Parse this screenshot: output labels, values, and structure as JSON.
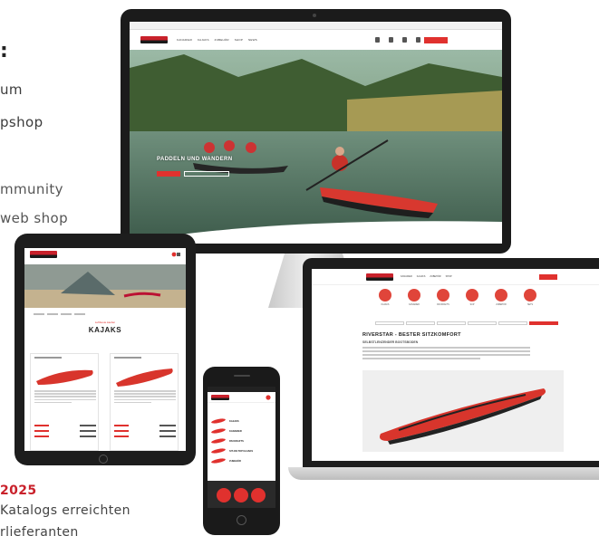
{
  "left_text": {
    "colon": ":",
    "line1": "um",
    "line2": "pshop",
    "line3": "mmunity",
    "line4": "web shop",
    "year": "2025",
    "line5": "Katalogs erreichten",
    "line6": "rlieferanten"
  },
  "desktop": {
    "nav_items": [
      "KANADIER",
      "KAJAKS",
      "ZUBEHÖR",
      "SHOP",
      "NEWS"
    ],
    "cta_label": "",
    "hero_headline": "PADDELN UND WANDERN"
  },
  "laptop": {
    "nav_items": [
      "KANADIER",
      "KAJAKS",
      "ZUBEHÖR",
      "SHOP"
    ],
    "category_labels": [
      "KAJAKS",
      "KANADIER",
      "PACKRAFTS",
      "SUP",
      "ZUBEHÖR",
      "SETS"
    ],
    "section_title": "RIVERSTAR - BESTER SITZKOMFORT",
    "section_subtitle": "SELBSTLENZENDER BOOTSBODEN"
  },
  "tablet": {
    "kicker": "Luftboote kaufen",
    "title": "KAJAKS"
  },
  "phone": {
    "menu_items": [
      "KAJAKS",
      "KANADIER",
      "PACKRAFTS",
      "SIT-ON-TOP KAJAKS",
      "ZUBEHÖR"
    ]
  },
  "colors": {
    "brand_red": "#e0312e",
    "device_black": "#1b1b1b"
  }
}
